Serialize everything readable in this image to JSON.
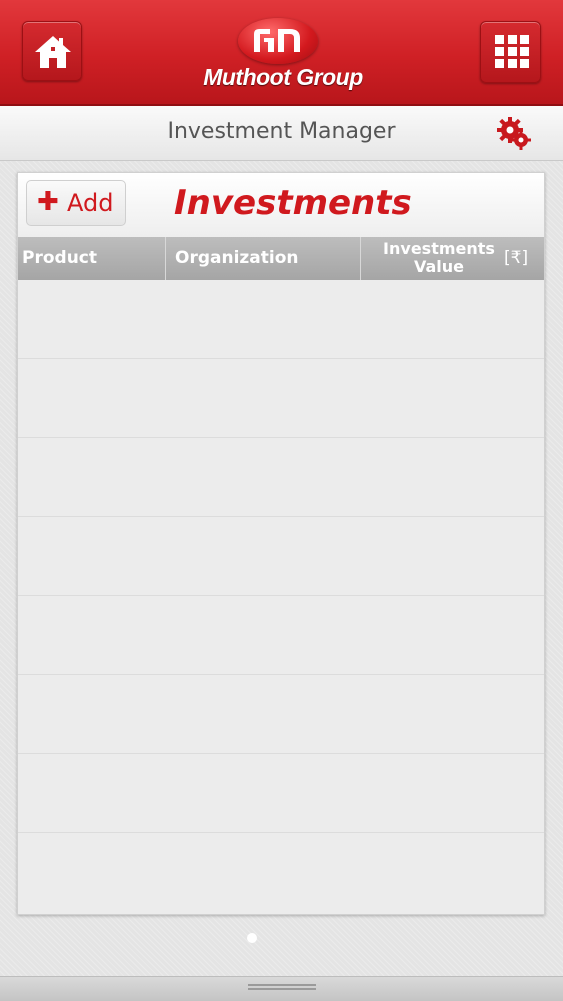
{
  "header": {
    "logo_text": "Muthoot Group",
    "home_icon": "home-icon",
    "menu_icon": "grid-menu-icon"
  },
  "subbar": {
    "title": "Investment Manager",
    "settings_icon": "gear-icon"
  },
  "card": {
    "add_label": "Add",
    "add_icon": "plus-icon",
    "title": "Investments",
    "columns": {
      "product": "Product",
      "organization": "Organization",
      "value": "Investments Value",
      "currency": "[₹]"
    },
    "rows": []
  },
  "colors": {
    "brand_red": "#d0191e",
    "header_gray": "#a5a5a5"
  },
  "pager": {
    "pages": 1,
    "current": 1
  }
}
